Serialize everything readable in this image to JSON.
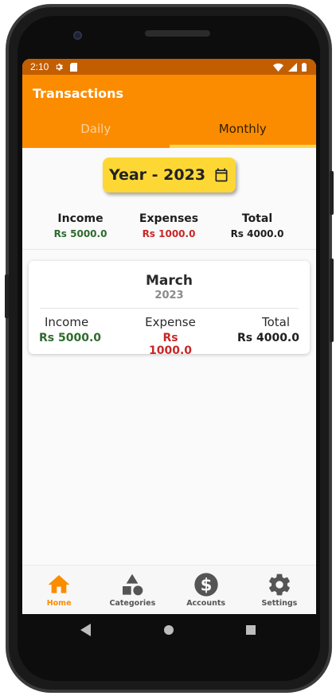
{
  "status_bar": {
    "time": "2:10"
  },
  "app_bar": {
    "title": "Transactions"
  },
  "tabs": [
    {
      "label": "Daily",
      "active": false
    },
    {
      "label": "Monthly",
      "active": true
    }
  ],
  "year_selector": {
    "label": "Year - 2023"
  },
  "summary": {
    "income": {
      "label": "Income",
      "value": "Rs 5000.0"
    },
    "expenses": {
      "label": "Expenses",
      "value": "Rs 1000.0"
    },
    "total": {
      "label": "Total",
      "value": "Rs 4000.0"
    }
  },
  "month_card": {
    "month": "March",
    "year": "2023",
    "income": {
      "label": "Income",
      "value": "Rs 5000.0"
    },
    "expense": {
      "label": "Expense",
      "value": "Rs 1000.0"
    },
    "total": {
      "label": "Total",
      "value": "Rs 4000.0"
    }
  },
  "bottom_nav": [
    {
      "label": "Home",
      "icon": "home-icon",
      "active": true
    },
    {
      "label": "Categories",
      "icon": "shapes-icon",
      "active": false
    },
    {
      "label": "Accounts",
      "icon": "dollar-icon",
      "active": false
    },
    {
      "label": "Settings",
      "icon": "gear-icon",
      "active": false
    }
  ],
  "colors": {
    "primary": "#fb8c00",
    "status_bar": "#c25e00",
    "accent": "#fdd835",
    "income": "#2e6b2e",
    "expense": "#c62828",
    "nav_inactive": "#555555"
  }
}
